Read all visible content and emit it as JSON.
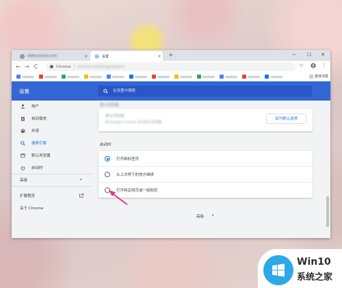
{
  "tabs": [
    {
      "title": "www.xxxxxx.com",
      "close": "×"
    },
    {
      "title": "设置",
      "close": "×"
    }
  ],
  "new_tab": "+",
  "window_controls": {
    "minimize": "−",
    "maximize": "☐",
    "close": "✕"
  },
  "toolbar": {
    "back": "←",
    "forward": "→",
    "reload": "C",
    "star": "☆",
    "menu": "⋮"
  },
  "omnibox": {
    "site": "Chrome",
    "separator": "|",
    "url": "chrome://settings/search"
  },
  "bookmarks_bar": {
    "last_label": "其他书签"
  },
  "header": {
    "title": "设置",
    "search_placeholder": "在设置中搜索"
  },
  "sidebar": {
    "items": [
      {
        "label": "用户",
        "icon": "person-icon"
      },
      {
        "label": "自动填充",
        "icon": "clipboard-icon"
      },
      {
        "label": "外观",
        "icon": "palette-icon"
      },
      {
        "label": "搜索引擎",
        "icon": "search-icon"
      },
      {
        "label": "默认浏览器",
        "icon": "browser-icon"
      },
      {
        "label": "启动时",
        "icon": "power-icon"
      }
    ],
    "advanced": "高级",
    "advanced_arrow": "▾",
    "extensions": "扩展程序",
    "about": "关于 Chrome"
  },
  "default_browser": {
    "section_title": "默认浏览器",
    "name": "默认浏览器",
    "sub": "将 Google Chrome 设为默认浏览器",
    "button": "设为默认选项"
  },
  "on_startup": {
    "section_title": "启动时",
    "options": [
      {
        "label": "打开新标签页",
        "checked": true
      },
      {
        "label": "从上次停下的地方继续",
        "checked": false
      },
      {
        "label": "打开特定网页或一组网页",
        "checked": false
      }
    ]
  },
  "advanced_footer": {
    "label": "高级",
    "arrow": "▾"
  },
  "accent_color": "#3367d6",
  "annotation_color": "#e8308a",
  "watermark": {
    "title": "Win10",
    "subtitle": "系统之家"
  }
}
